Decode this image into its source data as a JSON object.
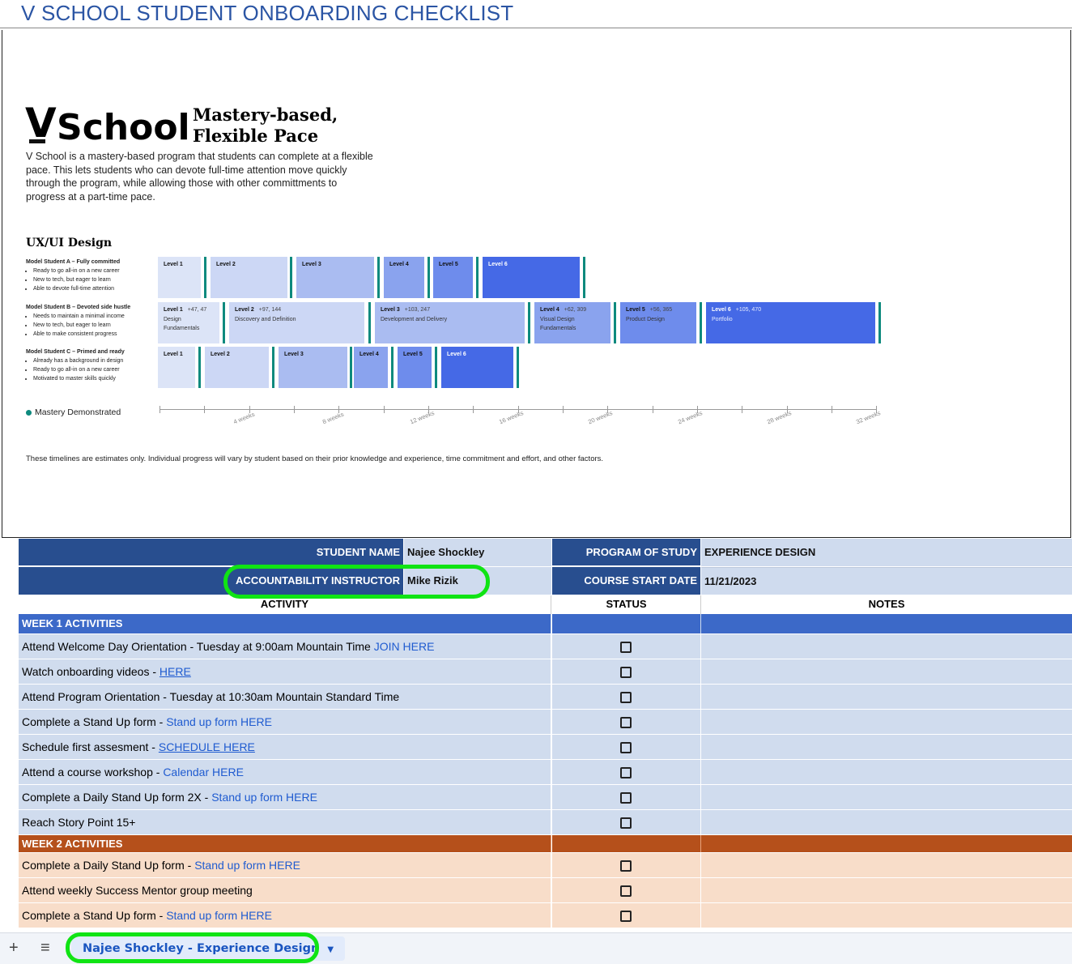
{
  "sheet_title": "V SCHOOL STUDENT ONBOARDING CHECKLIST",
  "infographic": {
    "logo_v": "V",
    "logo_school": "School",
    "tagline": "Mastery-based, Flexible Pace",
    "intro": "V School is a mastery-based program that students can complete at a flexible pace. This lets students who can devote full-time attention move quickly through the program, while allowing those with other committments to progress at a part-time pace.",
    "section_title": "UX/UI Design",
    "models": [
      {
        "title": "Model Student A – Fully committed",
        "bullets": [
          "Ready to go all-in on a new career",
          "New to tech, but eager to learn",
          "Able to devote full-time attention"
        ]
      },
      {
        "title": "Model Student B – Devoted side hustle",
        "bullets": [
          "Needs to maintain a minimal income",
          "New to tech, but eager to learn",
          "Able to make consistent progress"
        ]
      },
      {
        "title": "Model Student C – Primed and ready",
        "bullets": [
          "Already has a background in design",
          "Ready to go all-in on a new career",
          "Motivated to master skills quickly"
        ]
      }
    ],
    "row_a": [
      "Level 1",
      "Level 2",
      "Level 3",
      "Level 4",
      "Level 5",
      "Level 6"
    ],
    "row_b": [
      {
        "name": "Level 1",
        "meta": "+47, 47",
        "desc": "Design Fundamentals"
      },
      {
        "name": "Level 2",
        "meta": "+97, 144",
        "desc": "Discovery and Definition"
      },
      {
        "name": "Level 3",
        "meta": "+103, 247",
        "desc": "Development and Delivery"
      },
      {
        "name": "Level 4",
        "meta": "+62, 309",
        "desc": "Visual Design Fundamentals"
      },
      {
        "name": "Level 5",
        "meta": "+56, 365",
        "desc": "Product Design"
      },
      {
        "name": "Level 6",
        "meta": "+105, 470",
        "desc": "Portfolio"
      }
    ],
    "row_c": [
      "Level 1",
      "Level 2",
      "Level 3",
      "Level 4",
      "Level 5",
      "Level 6"
    ],
    "legend": "Mastery Demonstrated",
    "weeks": [
      "4 weeks",
      "8 weeks",
      "12 weeks",
      "16 weeks",
      "20 weeks",
      "24 weeks",
      "28 weeks",
      "32 weeks"
    ],
    "disclaimer": "These timelines are estimates only. Individual progress will vary by student based on their prior knowledge and experience, time commitment and effort, and other factors."
  },
  "header": {
    "student_name_label": "STUDENT NAME",
    "student_name": "Najee Shockley",
    "program_label": "PROGRAM OF STUDY",
    "program": "EXPERIENCE DESIGN",
    "instructor_label": "ACCOUNTABILITY INSTRUCTOR",
    "instructor": "Mike Rizik",
    "start_label": "COURSE START DATE",
    "start_date": "11/21/2023"
  },
  "columns": {
    "activity": "ACTIVITY",
    "status": "STATUS",
    "notes": "NOTES"
  },
  "week1": {
    "label": "WEEK 1 ACTIVITIES",
    "rows": [
      {
        "text": "Attend Welcome Day Orientation - Tuesday at 9:00am Mountain Time ",
        "link": "JOIN HERE"
      },
      {
        "text": "Watch onboarding videos - ",
        "link": "HERE"
      },
      {
        "text": "Attend Program Orientation - Tuesday at 10:30am Mountain Standard Time",
        "link": ""
      },
      {
        "text": "Complete a Stand Up form - ",
        "link": "Stand up form HERE"
      },
      {
        "text": "Schedule first assesment - ",
        "link": "SCHEDULE HERE"
      },
      {
        "text": "Attend a course workshop - ",
        "link": "Calendar HERE"
      },
      {
        "text": "Complete a Daily Stand Up form 2X - ",
        "link": "Stand up form HERE"
      },
      {
        "text": "Reach Story Point 15+",
        "link": ""
      }
    ]
  },
  "week2": {
    "label": "WEEK 2 ACTIVITIES",
    "rows": [
      {
        "text": "Complete a Daily Stand Up form - ",
        "link": "Stand up form HERE"
      },
      {
        "text": "Attend weekly Success Mentor group meeting",
        "link": ""
      },
      {
        "text": "Complete a Stand Up form  - ",
        "link": "Stand up form HERE"
      }
    ]
  },
  "tabs": {
    "add": "+",
    "menu": "≡",
    "active": "Najee Shockley - Experience Design",
    "caret": "▼"
  },
  "colors": {
    "title": "#2b55a4",
    "header": "#284e8f",
    "week1": "#3c69c8",
    "week2": "#b5501b",
    "highlight": "#10e414"
  }
}
